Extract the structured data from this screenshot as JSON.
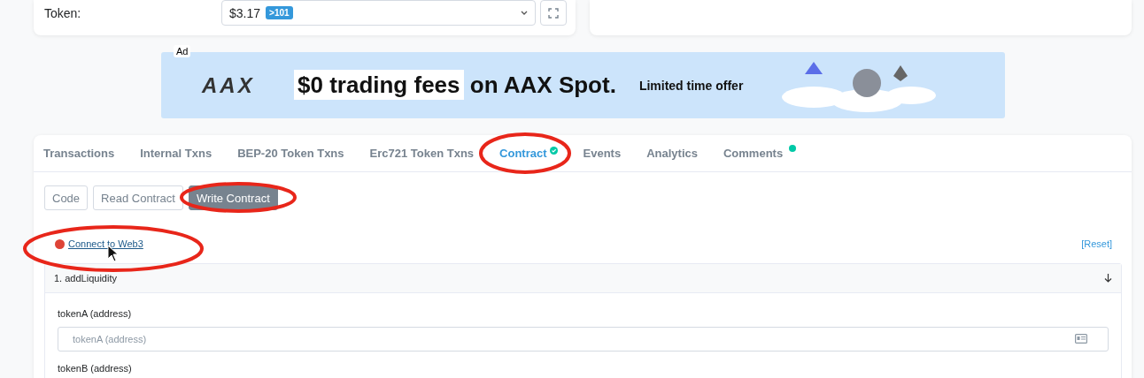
{
  "token_row": {
    "label": "Token:",
    "value": "$3.17",
    "badge": ">101"
  },
  "ad": {
    "label": "Ad",
    "logo": "AAX",
    "headline_highlight": "$0 trading fees",
    "headline_rest": "on AAX Spot.",
    "tagline": "Limited time offer"
  },
  "tabs": [
    {
      "label": "Transactions",
      "selected": false,
      "kind": "plain"
    },
    {
      "label": "Internal Txns",
      "selected": false,
      "kind": "plain"
    },
    {
      "label": "BEP-20 Token Txns",
      "selected": false,
      "kind": "plain"
    },
    {
      "label": "Erc721 Token Txns",
      "selected": false,
      "kind": "plain"
    },
    {
      "label": "Contract",
      "selected": true,
      "kind": "verified"
    },
    {
      "label": "Events",
      "selected": false,
      "kind": "plain"
    },
    {
      "label": "Analytics",
      "selected": false,
      "kind": "plain"
    },
    {
      "label": "Comments",
      "selected": false,
      "kind": "dot"
    }
  ],
  "sub_tabs": [
    {
      "label": "Code",
      "selected": false
    },
    {
      "label": "Read Contract",
      "selected": false
    },
    {
      "label": "Write Contract",
      "selected": true
    }
  ],
  "connect": {
    "label": "Connect to Web3",
    "connected": false,
    "reset": "[Reset]"
  },
  "functions": [
    {
      "title": "1. addLiquidity",
      "expanded": true,
      "inputs": [
        {
          "label": "tokenA (address)",
          "placeholder": "tokenA (address)"
        },
        {
          "label": "tokenB (address)"
        }
      ]
    }
  ]
}
